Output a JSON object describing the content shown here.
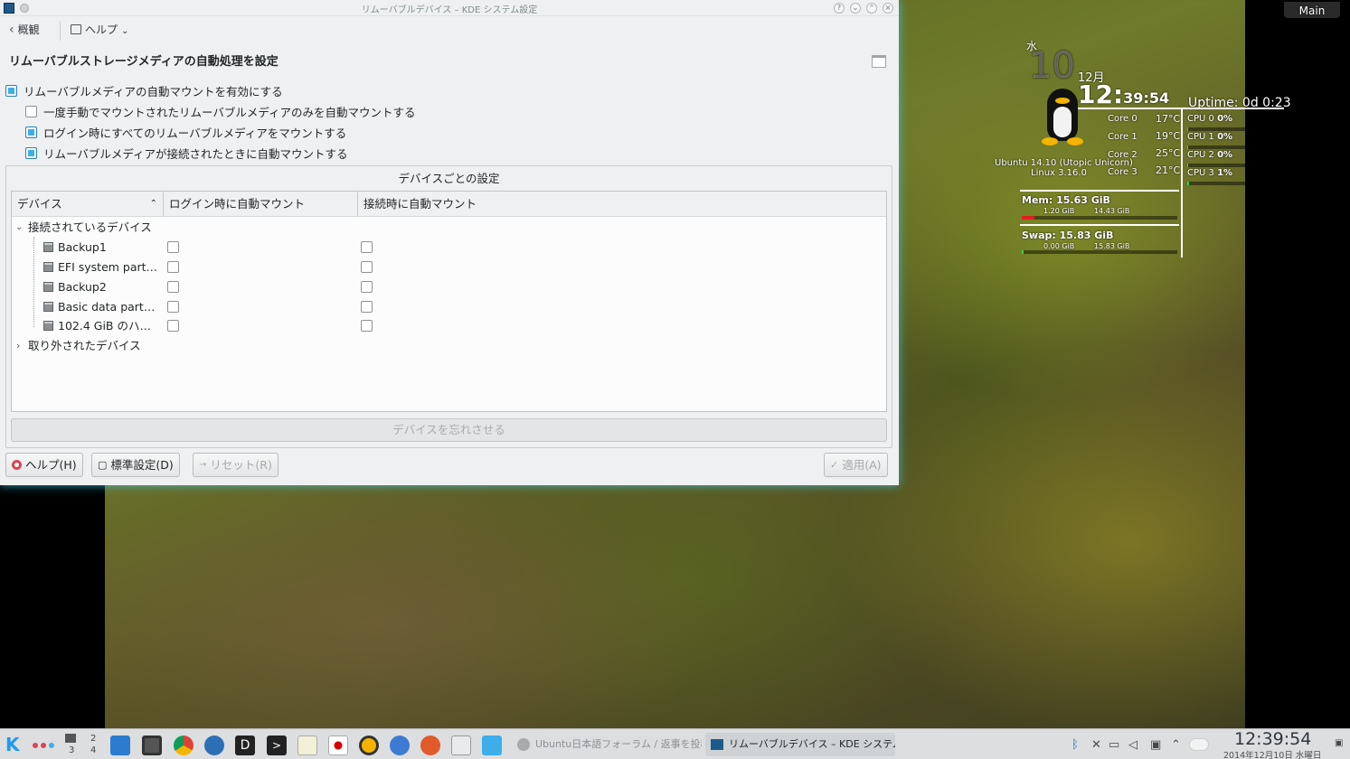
{
  "window": {
    "title": "リムーバブルデバイス – KDE システム設定",
    "nav_back": "概観",
    "nav_help": "ヘルプ",
    "heading": "リムーバブルストレージメディアの自動処理を設定",
    "options": [
      {
        "label": "リムーバブルメディアの自動マウントを有効にする",
        "checked": true
      },
      {
        "label": "一度手動でマウントされたリムーバブルメディアのみを自動マウントする",
        "checked": false
      },
      {
        "label": "ログイン時にすべてのリムーバブルメディアをマウントする",
        "checked": true
      },
      {
        "label": "リムーバブルメディアが接続されたときに自動マウントする",
        "checked": true
      }
    ],
    "group_title": "デバイスごとの設定",
    "columns": [
      "デバイス",
      "ログイン時に自動マウント",
      "接続時に自動マウント"
    ],
    "connected_label": "接続されているデバイス",
    "devices": [
      {
        "name": "Backup1"
      },
      {
        "name": "EFI system part…"
      },
      {
        "name": "Backup2"
      },
      {
        "name": "Basic data part…"
      },
      {
        "name": "102.4 GiB のハ…"
      }
    ],
    "removed_label": "取り外されたデバイス",
    "forget_button": "デバイスを忘れさせる",
    "help_button": "ヘルプ(H)",
    "defaults_button": "標準設定(D)",
    "reset_button": "リセット(R)",
    "apply_button": "適用(A)"
  },
  "desktop": {
    "main_label": "Main",
    "weekday": "水",
    "day": "10",
    "month": "12月",
    "time_big": "12:",
    "time_small": "39:54",
    "uptime": "Uptime: 0d 0:23",
    "os": "Ubuntu 14.10 (Utopic Unicorn)",
    "kernel": "Linux 3.16.0",
    "cores": [
      {
        "label": "Core 0",
        "temp": "17°C"
      },
      {
        "label": "Core 1",
        "temp": "19°C"
      },
      {
        "label": "Core 2",
        "temp": "25°C"
      },
      {
        "label": "Core 3",
        "temp": "21°C"
      }
    ],
    "cpus": [
      {
        "label": "CPU 0",
        "value": "0%"
      },
      {
        "label": "CPU 1",
        "value": "0%"
      },
      {
        "label": "CPU 2",
        "value": "0%"
      },
      {
        "label": "CPU 3",
        "value": "1%"
      }
    ],
    "mem": "Mem: 15.63 GiB",
    "mem_used": "1.20 GiB",
    "mem_free": "14.43 GiB",
    "swap": "Swap: 15.83 GiB",
    "swap_used": "0.00 GiB",
    "swap_free": "15.83 GiB"
  },
  "taskbar": {
    "pager": [
      "3",
      "2",
      "4"
    ],
    "task1": "Ubuntu日本語フォーラム / 返事を投稿…",
    "task2": "リムーバブルデバイス – KDE システム設定",
    "clock": "12:39:54",
    "date": "2014年12月10日 水曜日"
  }
}
